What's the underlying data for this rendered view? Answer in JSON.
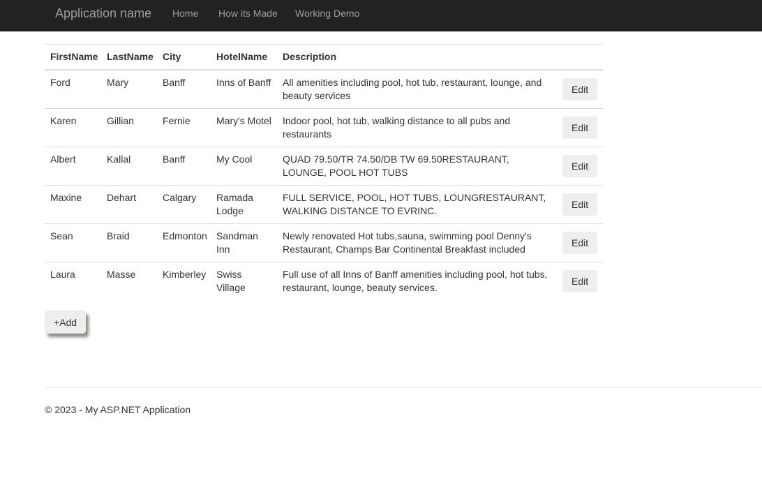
{
  "navbar": {
    "brand": "Application name",
    "links": [
      "Home",
      "How its Made",
      "Working Demo"
    ]
  },
  "table": {
    "headers": [
      "FirstName",
      "LastName",
      "City",
      "HotelName",
      "Description"
    ],
    "rows": [
      {
        "first": "Ford",
        "last": "Mary",
        "city": "Banff",
        "hotel": "Inns of Banff",
        "desc": "All amenities including pool, hot tub, restaurant, lounge, and beauty services"
      },
      {
        "first": "Karen",
        "last": "Gillian",
        "city": "Fernie",
        "hotel": "Mary's Motel",
        "desc": "Indoor pool, hot tub, walking distance to all pubs and restaurants"
      },
      {
        "first": "Albert",
        "last": "Kallal",
        "city": "Banff",
        "hotel": "My Cool",
        "desc": "QUAD 79.50/TR 74.50/DB TW 69.50RESTAURANT, LOUNGE, POOL HOT TUBS"
      },
      {
        "first": "Maxine",
        "last": "Dehart",
        "city": "Calgary",
        "hotel": "Ramada Lodge",
        "desc": "FULL SERVICE, POOL, HOT TUBS, LOUNGRESTAURANT, WALKING DISTANCE TO EVRINC."
      },
      {
        "first": "Sean",
        "last": "Braid",
        "city": "Edmonton",
        "hotel": "Sandman Inn",
        "desc": "Newly renovated Hot tubs,sauna, swimming pool Denny's Restaurant, Champs Bar Continental Breakfast included"
      },
      {
        "first": "Laura",
        "last": "Masse",
        "city": "Kimberley",
        "hotel": "Swiss Village",
        "desc": "Full use of all Inns of Banff amenities including pool, hot tubs, restaurant, lounge, beauty services."
      }
    ],
    "edit_label": "Edit"
  },
  "add_label": "+Add",
  "footer": "© 2023 - My ASP.NET Application"
}
